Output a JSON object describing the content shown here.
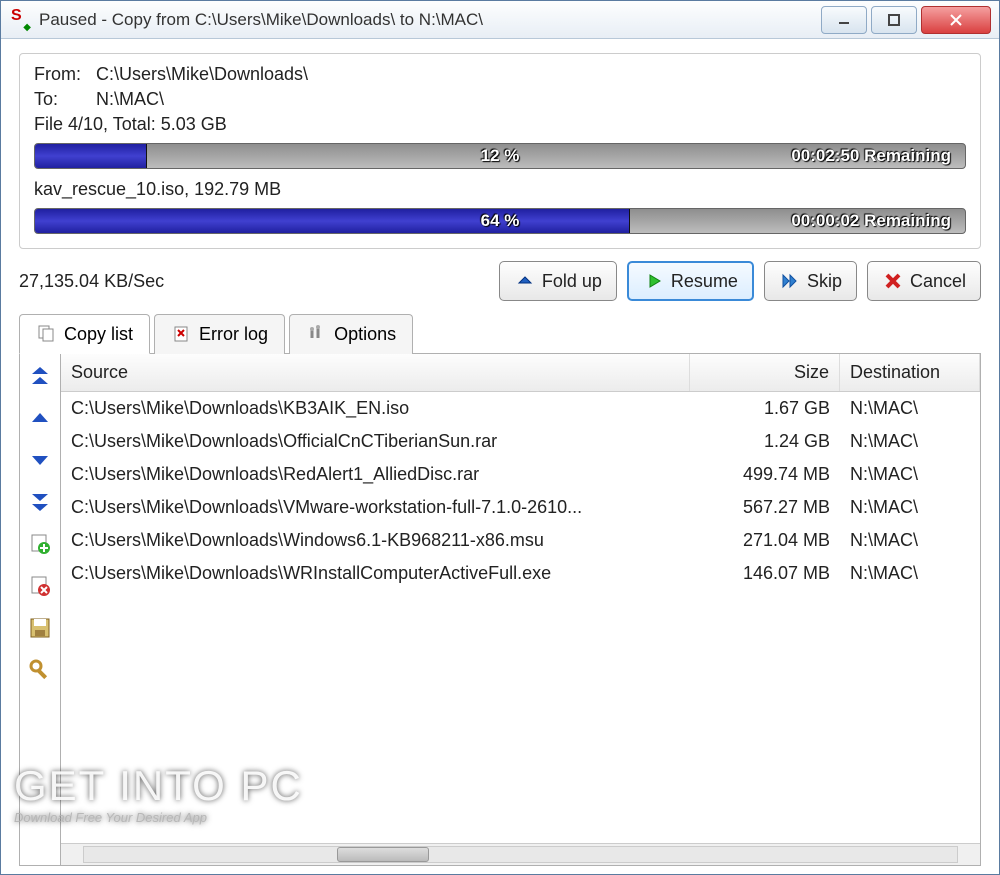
{
  "window": {
    "title": "Paused - Copy from C:\\Users\\Mike\\Downloads\\ to N:\\MAC\\"
  },
  "from_label": "From:",
  "from_path": "C:\\Users\\Mike\\Downloads\\",
  "to_label": "To:",
  "to_path": "N:\\MAC\\",
  "overall_status": "File 4/10, Total: 5.03 GB",
  "overall_percent": "12 %",
  "overall_percent_num": 12,
  "overall_remaining": "00:02:50 Remaining",
  "current_file": "kav_rescue_10.iso, 192.79 MB",
  "current_percent": "64 %",
  "current_percent_num": 64,
  "current_remaining": "00:00:02 Remaining",
  "speed": "27,135.04 KB/Sec",
  "buttons": {
    "fold": "Fold up",
    "resume": "Resume",
    "skip": "Skip",
    "cancel": "Cancel"
  },
  "tabs": {
    "copylist": "Copy list",
    "errorlog": "Error log",
    "options": "Options"
  },
  "headers": {
    "source": "Source",
    "size": "Size",
    "dest": "Destination"
  },
  "rows": [
    {
      "source": "C:\\Users\\Mike\\Downloads\\KB3AIK_EN.iso",
      "size": "1.67 GB",
      "dest": "N:\\MAC\\"
    },
    {
      "source": "C:\\Users\\Mike\\Downloads\\OfficialCnCTiberianSun.rar",
      "size": "1.24 GB",
      "dest": "N:\\MAC\\"
    },
    {
      "source": "C:\\Users\\Mike\\Downloads\\RedAlert1_AlliedDisc.rar",
      "size": "499.74 MB",
      "dest": "N:\\MAC\\"
    },
    {
      "source": "C:\\Users\\Mike\\Downloads\\VMware-workstation-full-7.1.0-2610...",
      "size": "567.27 MB",
      "dest": "N:\\MAC\\"
    },
    {
      "source": "C:\\Users\\Mike\\Downloads\\Windows6.1-KB968211-x86.msu",
      "size": "271.04 MB",
      "dest": "N:\\MAC\\"
    },
    {
      "source": "C:\\Users\\Mike\\Downloads\\WRInstallComputerActiveFull.exe",
      "size": "146.07 MB",
      "dest": "N:\\MAC\\"
    }
  ],
  "watermark": {
    "big": "GET INTO PC",
    "small": "Download Free Your Desired App"
  }
}
